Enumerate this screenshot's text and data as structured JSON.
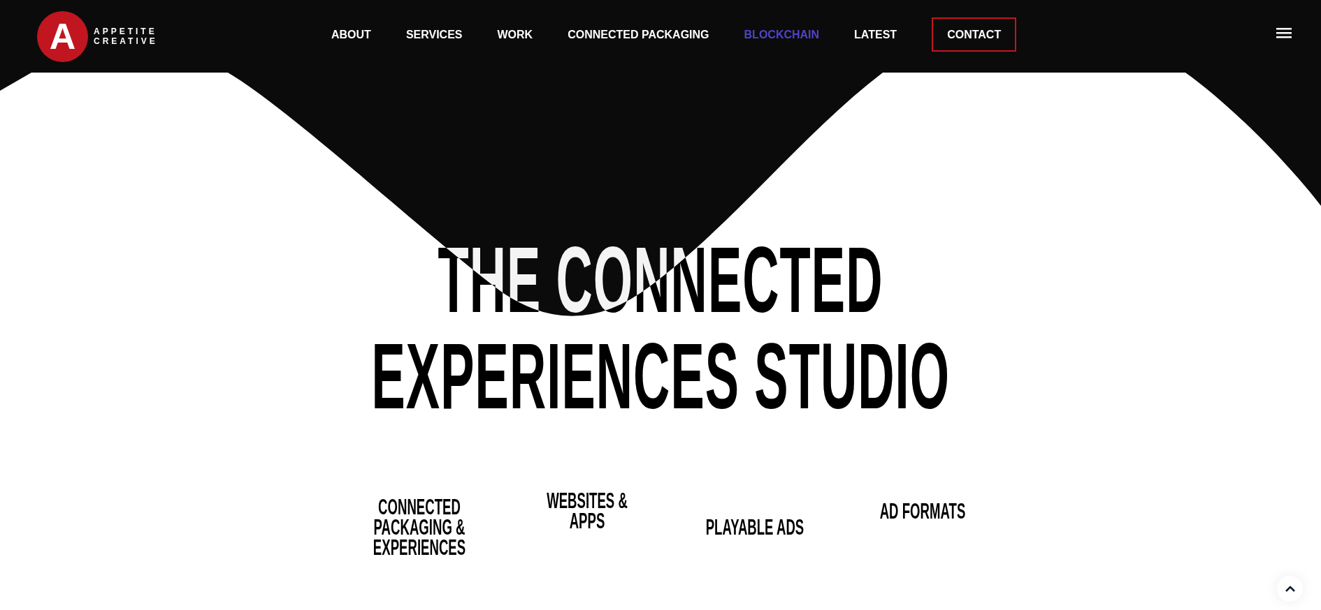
{
  "logo": {
    "mark": "A",
    "line_1": "APPETITE",
    "line_2": "CREATIVE"
  },
  "nav": [
    {
      "label": "ABOUT",
      "kind": "link",
      "selected": false
    },
    {
      "label": "SERVICES",
      "kind": "link",
      "selected": false
    },
    {
      "label": "WORK",
      "kind": "link",
      "selected": false
    },
    {
      "label": "CONNECTED PACKAGING",
      "kind": "link",
      "selected": false
    },
    {
      "label": "BLOCKCHAIN",
      "kind": "link",
      "selected": true
    },
    {
      "label": "LATEST",
      "kind": "link",
      "selected": false
    },
    {
      "label": "CONTACT",
      "kind": "button",
      "selected": false
    }
  ],
  "hero": {
    "headline_lines": [
      "THE CONNECTED",
      "EXPERIENCES STUDIO"
    ]
  },
  "services": [
    {
      "label": "CONNECTED PACKAGING & EXPERIENCES"
    },
    {
      "label": "WEBSITES & APPS"
    },
    {
      "label": "PLAYABLE ADS"
    },
    {
      "label": "AD FORMATS"
    }
  ]
}
